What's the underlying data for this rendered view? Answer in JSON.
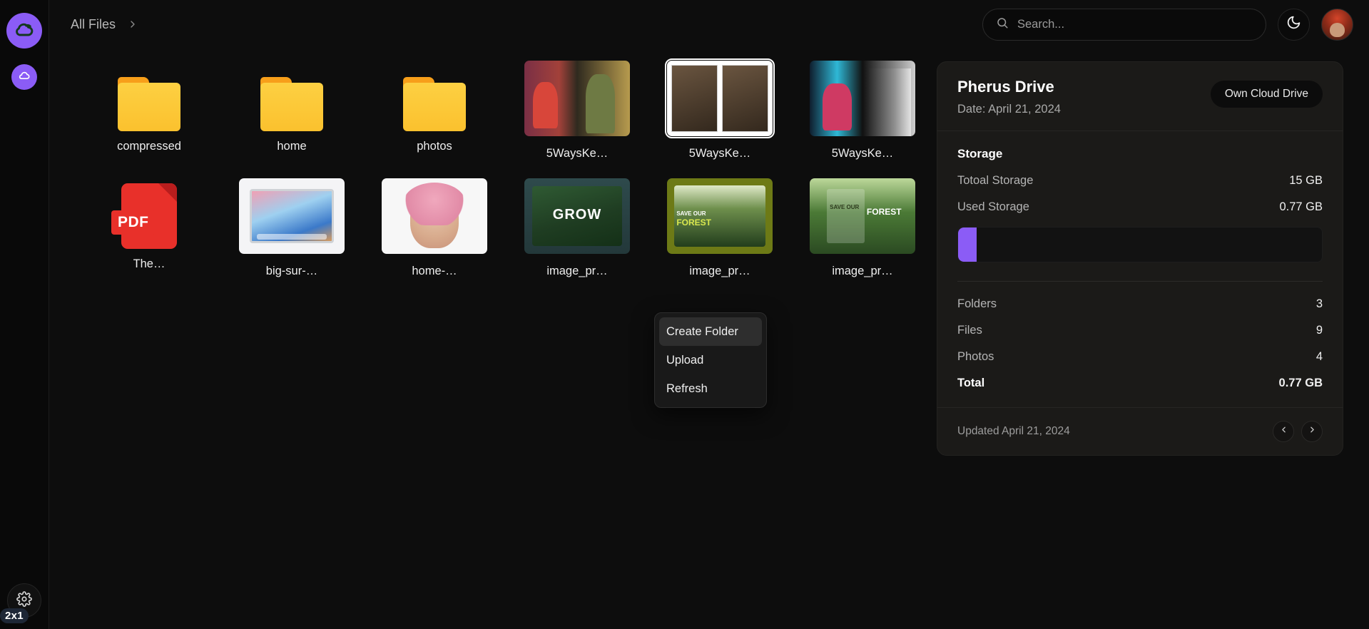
{
  "sidebar": {
    "brand_icon": "cloud-logo-icon",
    "drive_icon": "cloud-icon",
    "settings_icon": "gear-icon",
    "size_badge": "2x1",
    "accent_color": "#8b5cf6"
  },
  "topbar": {
    "breadcrumb": "All Files",
    "breadcrumb_sep_icon": "chevron-right-icon",
    "search": {
      "placeholder": "Search...",
      "value": "",
      "icon": "search-icon"
    },
    "theme_toggle_icon": "moon-icon",
    "avatar_icon": "user-avatar"
  },
  "files": [
    {
      "name": "compressed",
      "label": "compressed",
      "kind": "folder",
      "selected": false
    },
    {
      "name": "home",
      "label": "home",
      "kind": "folder",
      "selected": false
    },
    {
      "name": "photos",
      "label": "photos",
      "kind": "folder",
      "selected": false
    },
    {
      "name": "5waysket-1",
      "label": "5WaysKe…",
      "kind": "image-comic-a",
      "selected": false
    },
    {
      "name": "5waysket-2",
      "label": "5WaysKe…",
      "kind": "image-comic-b",
      "selected": true
    },
    {
      "name": "5waysket-3",
      "label": "5WaysKe…",
      "kind": "image-comic-c",
      "selected": false
    },
    {
      "name": "the-pdf",
      "label": "The…",
      "kind": "pdf",
      "selected": false
    },
    {
      "name": "big-sur",
      "label": "big-sur-…",
      "kind": "image-macbook",
      "selected": false
    },
    {
      "name": "home-img",
      "label": "home-…",
      "kind": "image-portrait",
      "selected": false
    },
    {
      "name": "image_pr-1",
      "label": "image_pr…",
      "kind": "image-grow",
      "selected": false
    },
    {
      "name": "image_pr-2",
      "label": "image_pr…",
      "kind": "image-forest1",
      "selected": false
    },
    {
      "name": "image_pr-3",
      "label": "image_pr…",
      "kind": "image-forest2",
      "selected": false
    }
  ],
  "context_menu": {
    "items": [
      {
        "label": "Create Folder",
        "active": true
      },
      {
        "label": "Upload",
        "active": false
      },
      {
        "label": "Refresh",
        "active": false
      }
    ]
  },
  "details": {
    "title": "Pherus Drive",
    "date": "Date: April 21, 2024",
    "badge": "Own Cloud Drive",
    "storage_section_title": "Storage",
    "total_storage_label": "Totoal Storage",
    "total_storage_value": "15 GB",
    "used_storage_label": "Used Storage",
    "used_storage_value": "0.77 GB",
    "progress_percent": 5,
    "progress_color": "#8b5cf6",
    "counts": [
      {
        "label": "Folders",
        "value": "3"
      },
      {
        "label": "Files",
        "value": "9"
      },
      {
        "label": "Photos",
        "value": "4"
      }
    ],
    "total_label": "Total",
    "total_value": "0.77 GB",
    "updated": "Updated April 21, 2024",
    "prev_icon": "chevron-left-icon",
    "next_icon": "chevron-right-icon"
  }
}
